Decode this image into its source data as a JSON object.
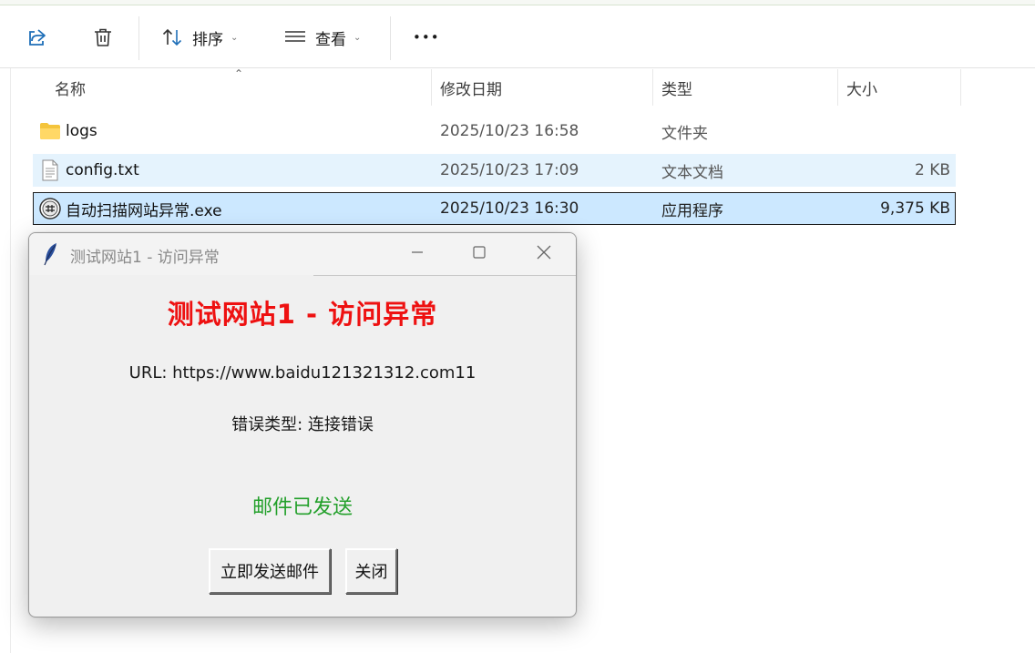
{
  "toolbar": {
    "share_icon": "share-icon",
    "delete_icon": "trash-icon",
    "sort_label": "排序",
    "view_label": "查看",
    "more_label": "•••"
  },
  "columns": {
    "name": "名称",
    "modified": "修改日期",
    "type": "类型",
    "size": "大小"
  },
  "files": [
    {
      "icon": "folder-icon",
      "name": "logs",
      "modified": "2025/10/23 16:58",
      "type": "文件夹",
      "size": ""
    },
    {
      "icon": "text-file-icon",
      "name": "config.txt",
      "modified": "2025/10/23 17:09",
      "type": "文本文档",
      "size": "2 KB"
    },
    {
      "icon": "exe-icon",
      "name": "自动扫描网站异常.exe",
      "modified": "2025/10/23 16:30",
      "type": "应用程序",
      "size": "9,375 KB"
    }
  ],
  "dialog": {
    "title": "测试网站1 - 访问异常",
    "heading": "测试网站1 - 访问异常",
    "url_line": "URL: https://www.baidu121321312.com11",
    "error_line": "错误类型: 连接错误",
    "status": "邮件已发送",
    "send_button": "立即发送邮件",
    "close_button": "关闭",
    "heading_color": "#ee1111",
    "status_color": "#23a02b"
  }
}
